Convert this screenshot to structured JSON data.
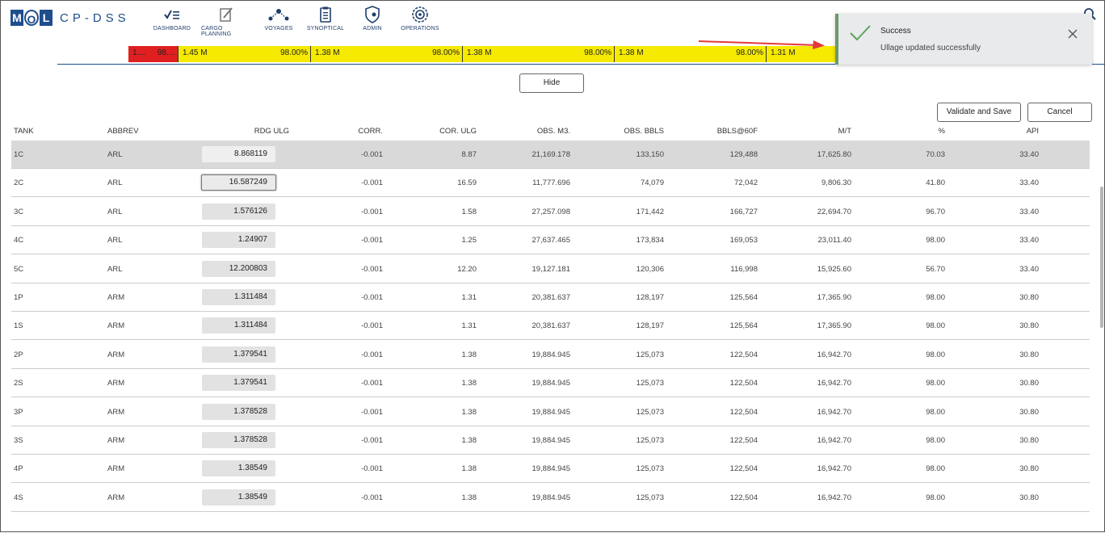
{
  "app": {
    "logo_letters": [
      "M",
      "O",
      "L"
    ],
    "name": "CP-DSS"
  },
  "nav": [
    {
      "label": "DASHBOARD",
      "icon": "dashboard-icon"
    },
    {
      "label": "CARGO PLANNING",
      "icon": "cargo-planning-icon"
    },
    {
      "label": "VOYAGES",
      "icon": "voyages-icon"
    },
    {
      "label": "SYNOPTICAL",
      "icon": "synoptical-icon"
    },
    {
      "label": "ADMIN",
      "icon": "admin-icon"
    },
    {
      "label": "OPERATIONS",
      "icon": "operations-icon"
    }
  ],
  "colors": {
    "brand": "#1f4e8c",
    "bar_red": "#e02020",
    "bar_yellow": "#f5ea00",
    "success": "#6a9a6a",
    "row_selected": "#d9d9d9"
  },
  "bar": {
    "segments": [
      {
        "a": "1....",
        "b": "98....",
        "color": "red"
      },
      {
        "a": "1.45 M",
        "b": "98.00%",
        "color": "yellow"
      },
      {
        "a": "1.38 M",
        "b": "98.00%",
        "color": "yellow"
      },
      {
        "a": "1.38 M",
        "b": "98.00%",
        "color": "yellow"
      },
      {
        "a": "1.38 M",
        "b": "98.00%",
        "color": "yellow"
      },
      {
        "a": "1.31 M",
        "b": "",
        "color": "yellow"
      }
    ]
  },
  "toast": {
    "title": "Success",
    "message": "Ullage updated successfully"
  },
  "buttons": {
    "hide": "Hide",
    "validate": "Validate and Save",
    "cancel": "Cancel"
  },
  "table": {
    "headers": {
      "tank": "TANK",
      "abbrev": "ABBREV",
      "rdg": "RDG ULG",
      "corr": "CORR.",
      "cor_ulg": "COR. ULG",
      "obs_m3": "OBS. M3.",
      "obs_bbls": "OBS. BBLS",
      "bbls60": "BBLS@60F",
      "mt": "M/T",
      "pct": "%",
      "api": "API"
    },
    "rows": [
      {
        "tank": "1C",
        "abbrev": "ARL",
        "rdg": "8.868119",
        "corr": "-0.001",
        "cor_ulg": "8.87",
        "obs_m3": "21,169.178",
        "obs_bbls": "133,150",
        "bbls60": "129,488",
        "mt": "17,625.80",
        "pct": "70.03",
        "api": "33.40"
      },
      {
        "tank": "2C",
        "abbrev": "ARL",
        "rdg": "16.587249",
        "corr": "-0.001",
        "cor_ulg": "16.59",
        "obs_m3": "11,777.696",
        "obs_bbls": "74,079",
        "bbls60": "72,042",
        "mt": "9,806.30",
        "pct": "41.80",
        "api": "33.40"
      },
      {
        "tank": "3C",
        "abbrev": "ARL",
        "rdg": "1.576126",
        "corr": "-0.001",
        "cor_ulg": "1.58",
        "obs_m3": "27,257.098",
        "obs_bbls": "171,442",
        "bbls60": "166,727",
        "mt": "22,694.70",
        "pct": "96.70",
        "api": "33.40"
      },
      {
        "tank": "4C",
        "abbrev": "ARL",
        "rdg": "1.24907",
        "corr": "-0.001",
        "cor_ulg": "1.25",
        "obs_m3": "27,637.465",
        "obs_bbls": "173,834",
        "bbls60": "169,053",
        "mt": "23,011.40",
        "pct": "98.00",
        "api": "33.40"
      },
      {
        "tank": "5C",
        "abbrev": "ARL",
        "rdg": "12.200803",
        "corr": "-0.001",
        "cor_ulg": "12.20",
        "obs_m3": "19,127.181",
        "obs_bbls": "120,306",
        "bbls60": "116,998",
        "mt": "15,925.60",
        "pct": "56.70",
        "api": "33.40"
      },
      {
        "tank": "1P",
        "abbrev": "ARM",
        "rdg": "1.311484",
        "corr": "-0.001",
        "cor_ulg": "1.31",
        "obs_m3": "20,381.637",
        "obs_bbls": "128,197",
        "bbls60": "125,564",
        "mt": "17,365.90",
        "pct": "98.00",
        "api": "30.80"
      },
      {
        "tank": "1S",
        "abbrev": "ARM",
        "rdg": "1.311484",
        "corr": "-0.001",
        "cor_ulg": "1.31",
        "obs_m3": "20,381.637",
        "obs_bbls": "128,197",
        "bbls60": "125,564",
        "mt": "17,365.90",
        "pct": "98.00",
        "api": "30.80"
      },
      {
        "tank": "2P",
        "abbrev": "ARM",
        "rdg": "1.379541",
        "corr": "-0.001",
        "cor_ulg": "1.38",
        "obs_m3": "19,884.945",
        "obs_bbls": "125,073",
        "bbls60": "122,504",
        "mt": "16,942.70",
        "pct": "98.00",
        "api": "30.80"
      },
      {
        "tank": "2S",
        "abbrev": "ARM",
        "rdg": "1.379541",
        "corr": "-0.001",
        "cor_ulg": "1.38",
        "obs_m3": "19,884.945",
        "obs_bbls": "125,073",
        "bbls60": "122,504",
        "mt": "16,942.70",
        "pct": "98.00",
        "api": "30.80"
      },
      {
        "tank": "3P",
        "abbrev": "ARM",
        "rdg": "1.378528",
        "corr": "-0.001",
        "cor_ulg": "1.38",
        "obs_m3": "19,884.945",
        "obs_bbls": "125,073",
        "bbls60": "122,504",
        "mt": "16,942.70",
        "pct": "98.00",
        "api": "30.80"
      },
      {
        "tank": "3S",
        "abbrev": "ARM",
        "rdg": "1.378528",
        "corr": "-0.001",
        "cor_ulg": "1.38",
        "obs_m3": "19,884.945",
        "obs_bbls": "125,073",
        "bbls60": "122,504",
        "mt": "16,942.70",
        "pct": "98.00",
        "api": "30.80"
      },
      {
        "tank": "4P",
        "abbrev": "ARM",
        "rdg": "1.38549",
        "corr": "-0.001",
        "cor_ulg": "1.38",
        "obs_m3": "19,884.945",
        "obs_bbls": "125,073",
        "bbls60": "122,504",
        "mt": "16,942.70",
        "pct": "98.00",
        "api": "30.80"
      },
      {
        "tank": "4S",
        "abbrev": "ARM",
        "rdg": "1.38549",
        "corr": "-0.001",
        "cor_ulg": "1.38",
        "obs_m3": "19,884.945",
        "obs_bbls": "125,073",
        "bbls60": "122,504",
        "mt": "16,942.70",
        "pct": "98.00",
        "api": "30.80"
      }
    ],
    "selected_index": 0,
    "focused_index": 1
  }
}
